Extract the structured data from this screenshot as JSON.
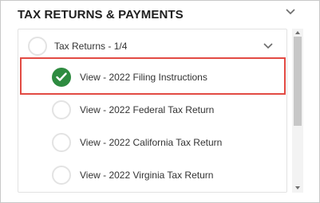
{
  "section": {
    "title": "TAX RETURNS & PAYMENTS"
  },
  "group": {
    "label": "Tax Returns - 1/4",
    "expanded": true
  },
  "items": [
    {
      "label": "View - 2022 Filing Instructions",
      "completed": true
    },
    {
      "label": "View - 2022 Federal Tax Return",
      "completed": false
    },
    {
      "label": "View - 2022 California Tax Return",
      "completed": false
    },
    {
      "label": "View - 2022 Virginia Tax Return",
      "completed": false
    }
  ],
  "icons": {
    "header": "chevron-down-icon",
    "group_toggle": "chevron-down-icon",
    "completed": "check-circle-icon",
    "pending": "empty-circle-icon"
  },
  "colors": {
    "completed": "#2e8b40",
    "highlight": "#e24a43"
  }
}
